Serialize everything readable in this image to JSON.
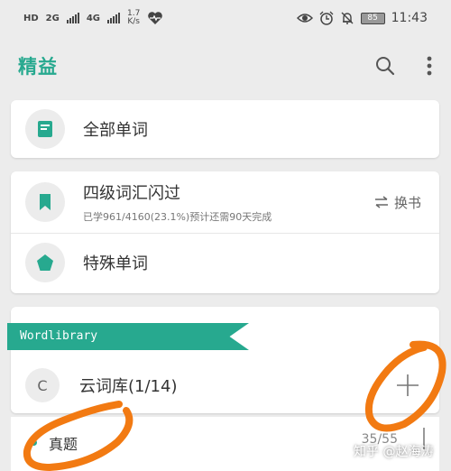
{
  "status_bar": {
    "hd": "HD",
    "signal_2g": "2G",
    "signal_4g": "4G",
    "speed_value": "1.7",
    "speed_unit": "K/s",
    "battery": "85",
    "time": "11:43"
  },
  "app_bar": {
    "title": "精益"
  },
  "menu": {
    "all_words": "全部单词",
    "cet4_title": "四级词汇闪过",
    "cet4_progress": "已学961/4160(23.1%)预计还需90天完成",
    "swap_book": "换书",
    "special_words": "特殊单词"
  },
  "library": {
    "ribbon": "Wordlibrary",
    "cloud_icon_letter": "C",
    "cloud_label": "云词库(1/14)"
  },
  "zhenti": {
    "label": "真题",
    "count": "35/55"
  },
  "watermark": "知乎 @赵海涛",
  "colors": {
    "accent": "#27a98f",
    "annotation": "#f27a12"
  },
  "icons": [
    "signal-icon",
    "heartbeat-icon",
    "eye-icon",
    "alarm-icon",
    "bell-off-icon",
    "search-icon",
    "more-vert-icon",
    "book-icon",
    "bookmark-icon",
    "pentagon-icon",
    "swap-icon",
    "plus-icon"
  ]
}
